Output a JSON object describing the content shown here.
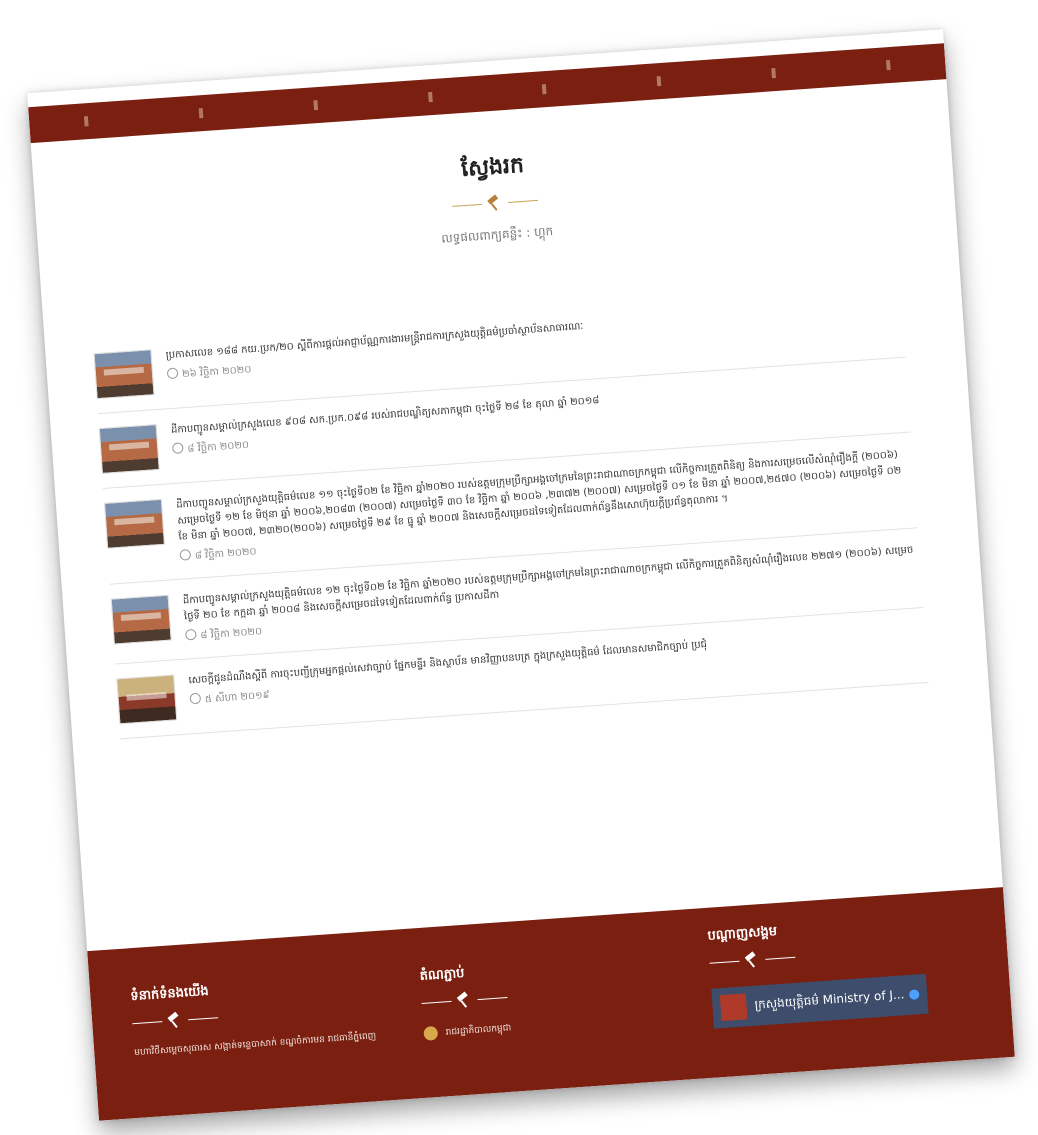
{
  "page": {
    "title": "ស្វែងរក",
    "subtitle": "លទ្ធផលពាក្យគន្លឹះ : ហ្គុក"
  },
  "results": [
    {
      "title": "ប្រកាសលេខ ១៨៨ កយ.ប្រក/២០ ស្ដីពីការផ្ដល់អាជ្ញាប័ណ្ណការងារមន្ត្រីរាជការក្រសួងយុត្តិធម៌ប្រចាំស្ថាប័នសាធារណៈ",
      "date": "២៦ វិច្ឆិកា ២០២០",
      "thumb": "building-photo"
    },
    {
      "title": "ដីកាបញ្ជូនសម្គាល់ក្រសួងលេខ ៩០៨ សក.ប្រក.០៩៨ របស់រាជបណ្ឌិត្យសភាកម្ពុជា ចុះថ្ងៃទី ២៨ ខែ តុលា ឆ្នាំ ២០១៨",
      "date": "៨ វិច្ឆិកា ២០២០",
      "thumb": "building-photo"
    },
    {
      "title": "ដីកាបញ្ជូនសម្គាល់ក្រសួងយុត្តិធម៌លេខ ១១ ចុះថ្ងៃទី០២ ខែ វិច្ឆិកា ឆ្នាំ២០២០ របស់ឧត្តមក្រុមប្រឹក្សាអង្គចៅក្រមនៃព្រះរាជាណាចក្រកម្ពុជា លើកិច្ចការត្រួតពិនិត្យ និងការសម្រេចលើសំណុំរឿងក្ដី (២០០៦) សម្រេចថ្ងៃទី ១២ ខែ មិថុនា ឆ្នាំ ២០០៦,២០៨៣ (២០០៧) សម្រេចថ្ងៃទី ៣០ ខែ វិច្ឆិកា ឆ្នាំ ២០០៦ ,២៣៧២ (២០០៧) សម្រេចថ្ងៃទី ០១ ខែ មិនា ឆ្នាំ ២០០៧,២៥៧០ (២០០៦) សម្រេចថ្ងៃទី ០២ ខែ មិនា ឆ្នាំ ២០០៧, ២៣២០(២០០៦) សម្រេចថ្ងៃទី ២៩ ខែ ធ្នូ ឆ្នាំ ២០០៧ និងសេចក្ដីសម្រេចដទៃទៀតដែលពាក់ព័ន្ធនឹងសោហ៊ុយក្ដីប្រព័ន្ធតុលាការ ។",
      "date": "៨ វិច្ឆិកា ២០២០",
      "thumb": "building-photo"
    },
    {
      "title": "ដីកាបញ្ជូនសម្គាល់ក្រសួងយុត្តិធម៌លេខ ១២ ចុះថ្ងៃទី០២ ខែ វិច្ឆិកា ឆ្នាំ២០២០ របស់ឧត្តមក្រុមប្រឹក្សាអង្គចៅក្រមនៃព្រះរាជាណាចក្រកម្ពុជា លើកិច្ចការត្រួតពិនិត្យសំណុំរឿងលេខ ២២៧១ (២០០៦) សម្រេចថ្ងៃទី ២០ ខែ កក្កដា ឆ្នាំ ២០០៨ និងសេចក្ដីសម្រេចដទៃទៀតដែលពាក់ព័ន្ធ ប្រកាសដីកា",
      "date": "៨ វិច្ឆិកា ២០២០",
      "thumb": "building-photo"
    },
    {
      "title": "សេចក្ដីជូនដំណឹងស្ដីពី ការចុះបញ្ជីក្រុមអ្នកផ្ដល់សេវាច្បាប់ ផ្នែកមន្ទីរ និងស្ថាប័ន មានវិញ្ញាបនបត្រ ក្នុងក្រសួងយុត្តិធម៌ ដែលមានសមាជិកច្បាប់ ប្រជុំ",
      "date": "៥ សីហា ២០១៩",
      "thumb": "indoor-photo"
    }
  ],
  "footer": {
    "col1_title": "ទំនាក់ទំនងយើង",
    "col1_text": "មហាវិថីសម្ដេចសុធារស សង្កាត់ទន្លេបាសាក់ ខណ្ឌចំការមន រាជធានីភ្នំពេញ",
    "col2_title": "តំណភ្ជាប់",
    "col2_link": "រាជរដ្ឋាភិបាលកម្ពុជា",
    "col3_title": "បណ្ដាញសង្គម",
    "fb_label": "ក្រសួងយុត្តិធម៌ Ministry of J...",
    "fb_icon": "globe-icon"
  }
}
